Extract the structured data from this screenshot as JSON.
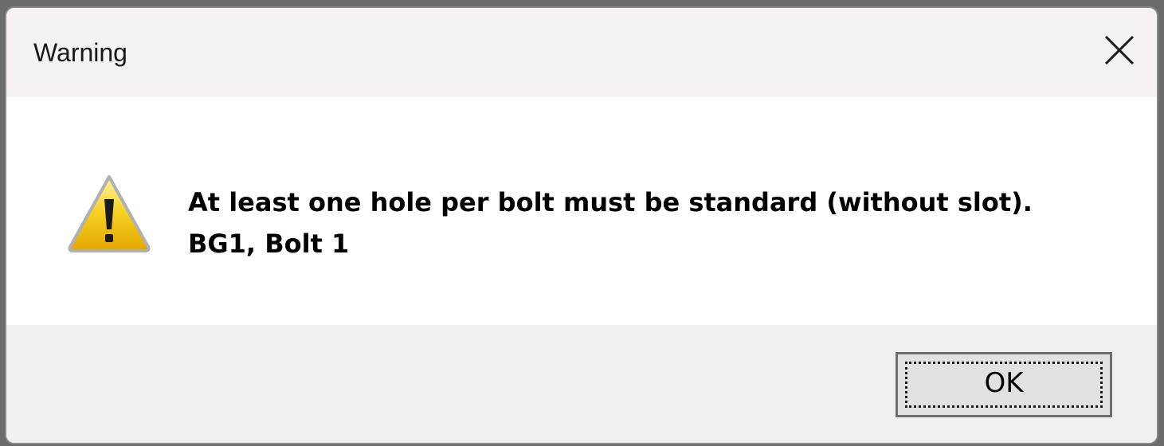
{
  "window": {
    "title": "Warning",
    "close_icon": "close-icon"
  },
  "message": {
    "icon": "warning-icon",
    "line1": "At least one hole per bolt must be standard (without slot).",
    "line2": "BG1, Bolt 1"
  },
  "buttons": {
    "ok_label": "OK"
  },
  "colors": {
    "titlebar_bg": "#f6f2f1",
    "content_bg": "#ffffff",
    "footer_bg": "#f0f0f0",
    "warning_yellow": "#f2c200"
  }
}
